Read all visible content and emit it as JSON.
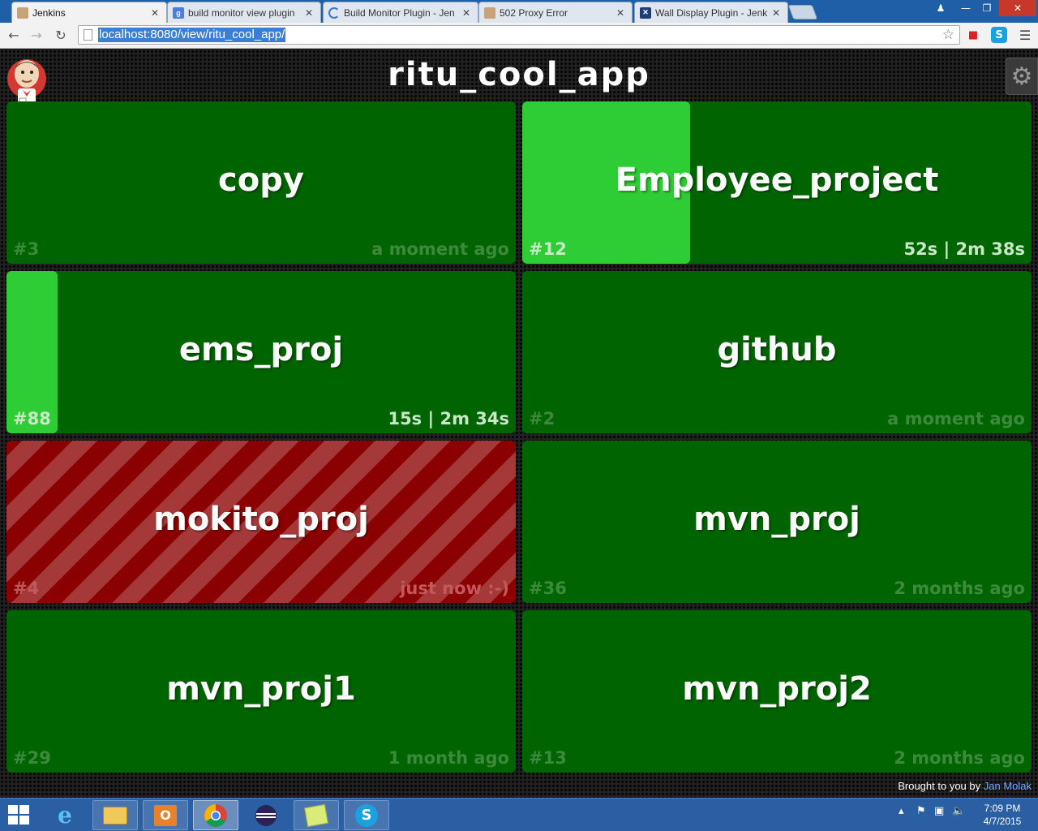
{
  "browser": {
    "tabs": [
      {
        "title": "Jenkins",
        "active": true
      },
      {
        "title": "build monitor view plugin",
        "active": false
      },
      {
        "title": "Build Monitor Plugin - Jen",
        "active": false
      },
      {
        "title": "502 Proxy Error",
        "active": false
      },
      {
        "title": "Wall Display Plugin - Jenk",
        "active": false
      }
    ],
    "url": "localhost:8080/view/ritu_cool_app/"
  },
  "monitor": {
    "view_title": "ritu_cool_app",
    "jobs": [
      {
        "name": "copy",
        "build": "#3",
        "timing": "a moment ago",
        "status": "successful"
      },
      {
        "name": "Employee_project",
        "build": "#12",
        "timing": "52s | 2m 38s",
        "status": "successful-building",
        "progress": 0.33
      },
      {
        "name": "ems_proj",
        "build": "#88",
        "timing": "15s | 2m 34s",
        "status": "successful-building",
        "progress": 0.1
      },
      {
        "name": "github",
        "build": "#2",
        "timing": "a moment ago",
        "status": "successful"
      },
      {
        "name": "mokito_proj",
        "build": "#4",
        "timing": "just now :-)",
        "status": "failing"
      },
      {
        "name": "mvn_proj",
        "build": "#36",
        "timing": "2 months ago",
        "status": "successful"
      },
      {
        "name": "mvn_proj1",
        "build": "#29",
        "timing": "1 month ago",
        "status": "successful"
      },
      {
        "name": "mvn_proj2",
        "build": "#13",
        "timing": "2 months ago",
        "status": "successful"
      }
    ],
    "credit": {
      "prefix": "Brought to you by",
      "author": "Jan Molak"
    }
  },
  "taskbar": {
    "clock": {
      "time": "7:09 PM",
      "date": "4/7/2015"
    }
  },
  "colors": {
    "success": "#006400",
    "building": "#2ecc35",
    "failure": "#8b0000"
  }
}
